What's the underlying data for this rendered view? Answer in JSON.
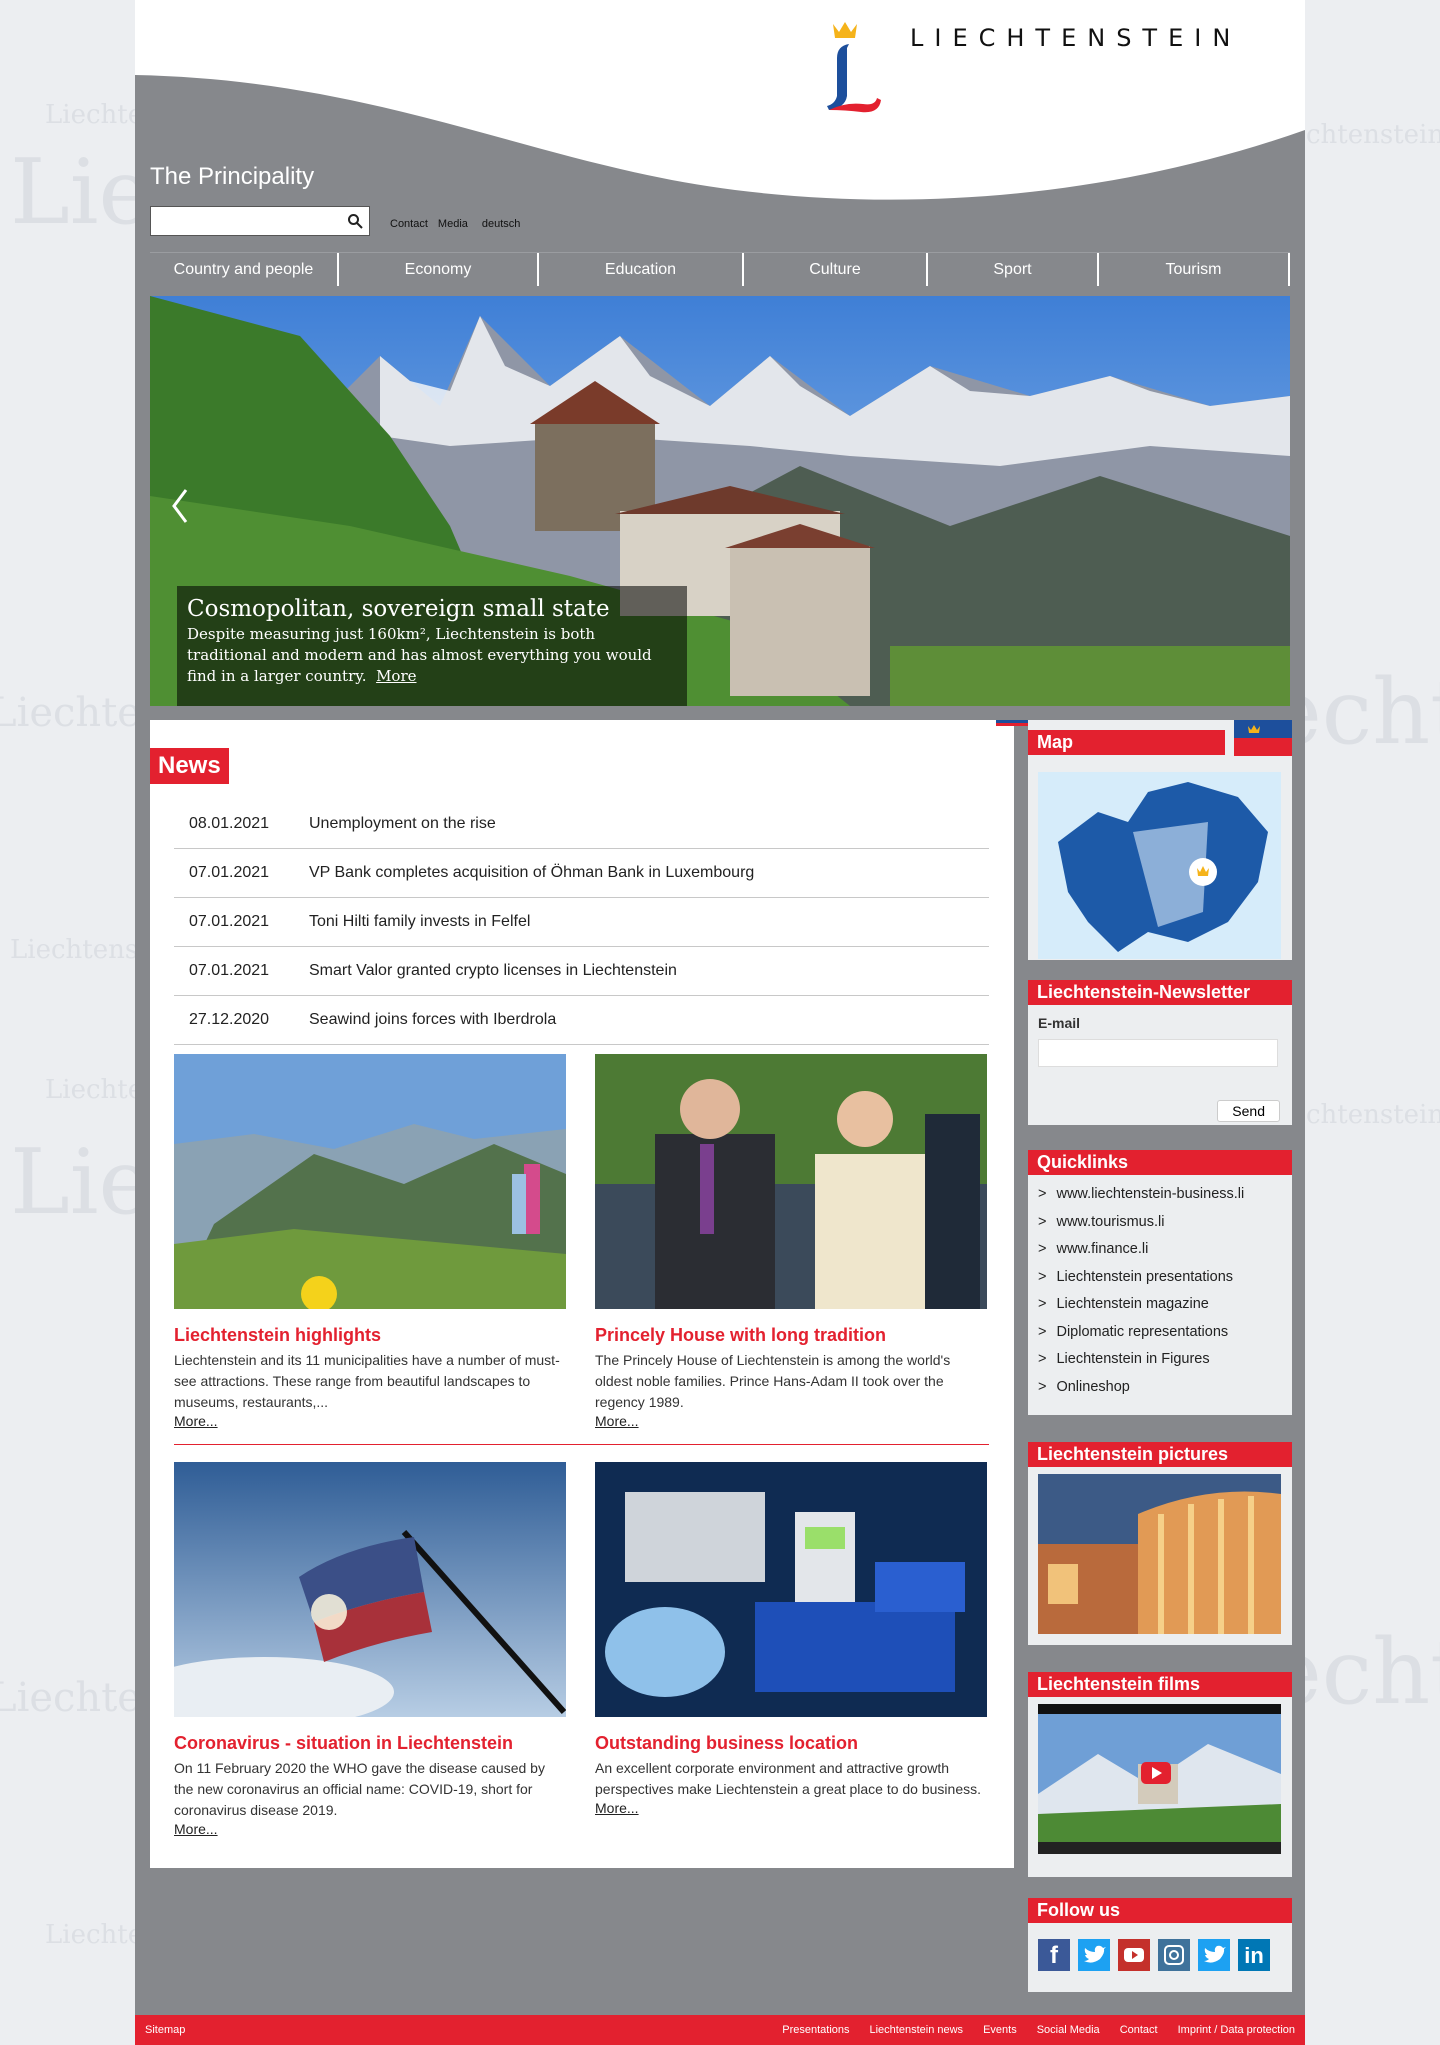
{
  "brand": {
    "name": "LIECHTENSTEIN",
    "watermark_word": "Liechtenstein"
  },
  "header": {
    "site_title": "The Principality",
    "search": {
      "value": "",
      "placeholder": ""
    },
    "util_links": [
      "Contact",
      "Media",
      "deutsch"
    ]
  },
  "nav": [
    "Country and people",
    "Economy",
    "Education",
    "Culture",
    "Sport",
    "Tourism"
  ],
  "hero": {
    "title": "Cosmopolitan, sovereign small state",
    "text": "Despite measuring just 160km², Liechtenstein is both traditional and modern and has almost everything you would find in a larger country.",
    "more": "More"
  },
  "news": {
    "heading": "News",
    "items": [
      {
        "date": "08.01.2021",
        "title": "Unemployment on the rise"
      },
      {
        "date": "07.01.2021",
        "title": "VP Bank completes acquisition of Öhman Bank in Luxembourg"
      },
      {
        "date": "07.01.2021",
        "title": "Toni Hilti family invests in Felfel"
      },
      {
        "date": "07.01.2021",
        "title": "Smart Valor granted crypto licenses in Liechtenstein"
      },
      {
        "date": "27.12.2020",
        "title": "Seawind joins forces with Iberdrola"
      }
    ]
  },
  "teasers": [
    {
      "title": "Liechtenstein highlights",
      "text": "Liechtenstein and its 11 municipalities have a number of must-see attractions. These range from beautiful landscapes to museums, restaurants,...",
      "more": "More..."
    },
    {
      "title": "Princely House with long tradition",
      "text": "The Princely House of Liechtenstein is among the world's oldest noble families. Prince Hans-Adam II took over the regency 1989.",
      "more": "More..."
    },
    {
      "title": "Coronavirus - situation in Liechtenstein",
      "text": "On 11 February 2020 the WHO gave the disease caused by the new coronavirus an official name: COVID-19, short for coronavirus disease 2019.",
      "more": "More..."
    },
    {
      "title": "Outstanding business location",
      "text": "An excellent corporate environment and attractive growth perspectives make Liechtenstein a great place to do business.",
      "more": "More..."
    }
  ],
  "sidebar": {
    "map_title": "Map",
    "newsletter": {
      "title": "Liechtenstein-Newsletter",
      "email_label": "E-mail",
      "email_value": "",
      "send": "Send"
    },
    "quicklinks": {
      "title": "Quicklinks",
      "items": [
        "www.liechtenstein-business.li",
        "www.tourismus.li",
        "www.finance.li",
        "Liechtenstein presentations",
        "Liechtenstein magazine",
        "Diplomatic representations",
        "Liechtenstein in Figures",
        "Onlineshop"
      ]
    },
    "pictures_title": "Liechtenstein pictures",
    "films_title": "Liechtenstein films",
    "follow_title": "Follow us"
  },
  "footer": {
    "sitemap": "Sitemap",
    "links": [
      "Presentations",
      "Liechtenstein news",
      "Events",
      "Social Media",
      "Contact",
      "Imprint / Data protection"
    ]
  },
  "colors": {
    "accent": "#e3212f",
    "frame": "#86888c",
    "nav_blue": "#1d4f9c"
  }
}
